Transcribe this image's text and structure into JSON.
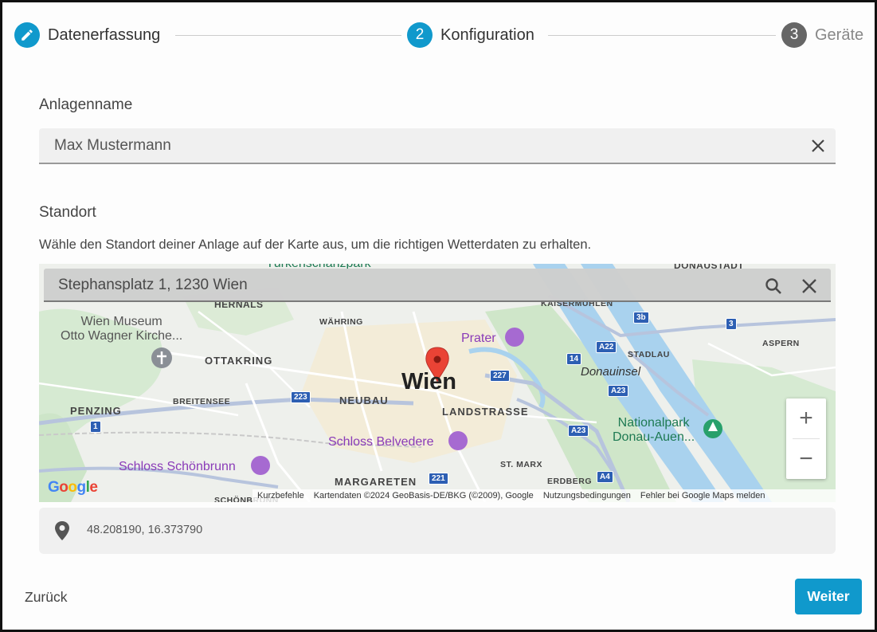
{
  "stepper": {
    "steps": [
      {
        "number": "",
        "label": "Datenerfassung",
        "state": "completed"
      },
      {
        "number": "2",
        "label": "Konfiguration",
        "state": "active"
      },
      {
        "number": "3",
        "label": "Geräte",
        "state": "upcoming"
      }
    ]
  },
  "form": {
    "name_label": "Anlagenname",
    "name_value": "Max Mustermann",
    "location_label": "Standort",
    "location_hint": "Wähle den Standort deiner Anlage auf der Karte aus, um die richtigen Wetterdaten zu erhalten."
  },
  "map": {
    "search_value": "Stephansplatz 1, 1230 Wien",
    "labels": {
      "city": "Wien",
      "hernals": "HERNALS",
      "waehring": "WÄHRING",
      "ottakring": "OTTAKRING",
      "breitensee": "BREITENSEE",
      "penzing": "PENZING",
      "neubau": "NEUBAU",
      "landstrasse": "LANDSTRASSE",
      "margareten": "MARGARETEN",
      "st_marx": "ST. MARX",
      "erdberg": "ERDBERG",
      "stadlau": "STADLAU",
      "aspern": "ASPERN",
      "kaisermuehlen": "KAISERMÜHLEN",
      "schoenbrunn_district": "SCHÖNBRUNN",
      "tuerkenschanzpark": "Türkenschanzpark",
      "donaustadt": "DONAUSTADT",
      "wien_museum_1": "Wien Museum",
      "wien_museum_2": "Otto Wagner Kirche...",
      "prater": "Prater",
      "donauinsel": "Donauinsel",
      "nationalpark_1": "Nationalpark",
      "nationalpark_2": "Donau-Auen...",
      "schloss_belvedere": "Schloss Belvedere",
      "schloss_schoenbrunn": "Schloss Schönbrunn"
    },
    "shields": {
      "a22": "A22",
      "a23a": "A23",
      "a23b": "A23",
      "a4": "A4",
      "r227": "227",
      "r223": "223",
      "r221": "221",
      "r14": "14",
      "r3b": "3b",
      "r3": "3",
      "r1": "1"
    },
    "zoom_in": "+",
    "zoom_out": "−",
    "google": "Google",
    "attribution": {
      "shortcuts": "Kurzbefehle",
      "data": "Kartendaten ©2024 GeoBasis-DE/BKG (©2009), Google",
      "terms": "Nutzungsbedingungen",
      "report": "Fehler bei Google Maps melden"
    }
  },
  "coordinates": "48.208190, 16.373790",
  "actions": {
    "back": "Zurück",
    "next": "Weiter"
  },
  "colors": {
    "primary": "#1099cc",
    "step_inactive": "#666666",
    "map_pin": "#ea4335"
  }
}
